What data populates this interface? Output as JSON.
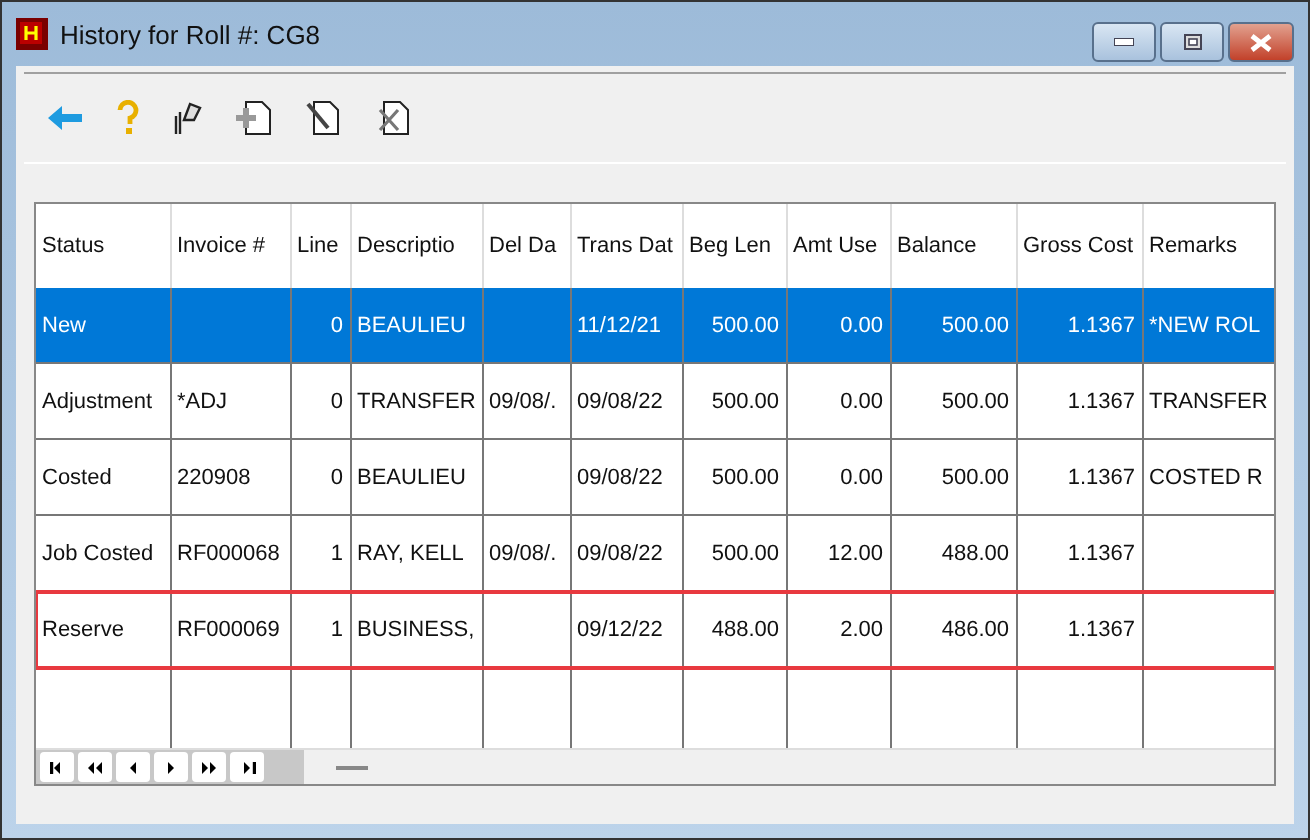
{
  "window": {
    "title": "History for Roll #: CG8"
  },
  "table": {
    "columns": [
      "Status",
      "Invoice #",
      "Line",
      "Descriptio",
      "Del Da",
      "Trans Dat",
      "Beg Len",
      "Amt Use",
      "Balance",
      "Gross Cost",
      "Remarks"
    ],
    "rows": [
      {
        "selected": true,
        "outlined": false,
        "cells": [
          "New",
          null,
          "0",
          "BEAULIEU",
          null,
          "11/12/21",
          "500.00",
          "0.00",
          "500.00",
          "1.1367",
          "*NEW ROL"
        ]
      },
      {
        "selected": false,
        "outlined": false,
        "cells": [
          "Adjustment",
          "*ADJ",
          "0",
          "TRANSFER",
          "09/08/.",
          "09/08/22",
          "500.00",
          "0.00",
          "500.00",
          "1.1367",
          "TRANSFER"
        ]
      },
      {
        "selected": false,
        "outlined": false,
        "cells": [
          "Costed",
          "220908",
          "0",
          "BEAULIEU",
          null,
          "09/08/22",
          "500.00",
          "0.00",
          "500.00",
          "1.1367",
          "COSTED R"
        ]
      },
      {
        "selected": false,
        "outlined": false,
        "cells": [
          "Job Costed",
          "RF000068",
          "1",
          "RAY, KELL",
          "09/08/.",
          "09/08/22",
          "500.00",
          "12.00",
          "488.00",
          "1.1367",
          null
        ]
      },
      {
        "selected": false,
        "outlined": true,
        "cells": [
          "Reserve",
          "RF000069",
          "1",
          "BUSINESS,",
          null,
          "09/12/22",
          "488.00",
          "2.00",
          "486.00",
          "1.1367",
          null
        ]
      }
    ]
  }
}
